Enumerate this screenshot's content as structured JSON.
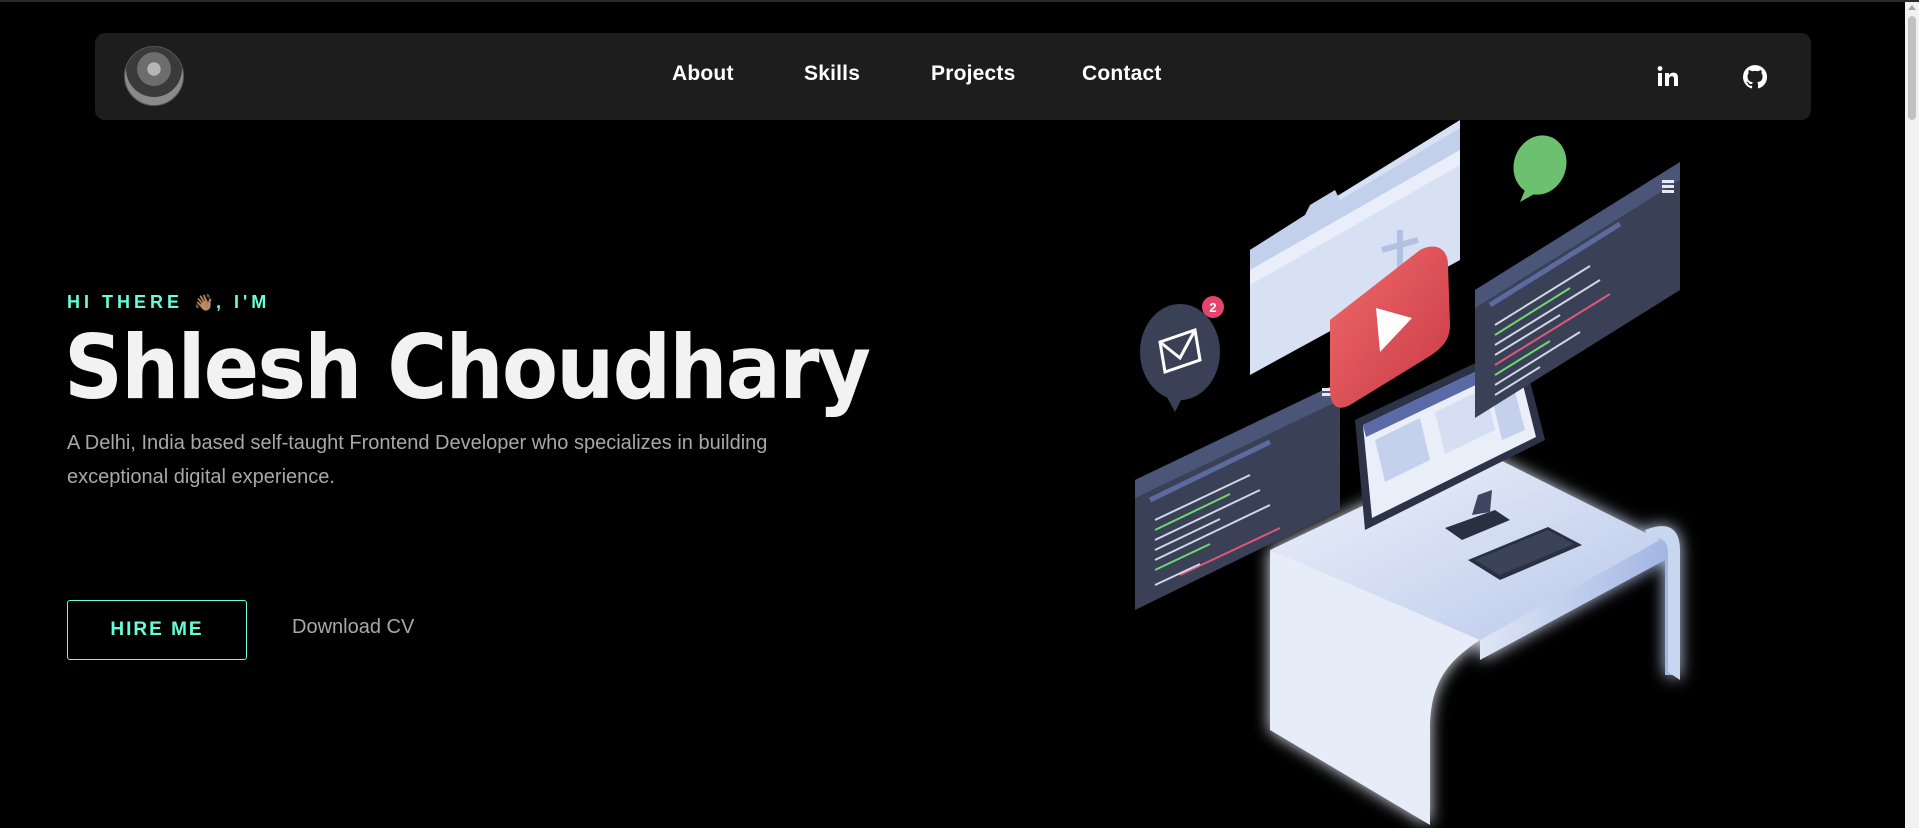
{
  "nav": {
    "links": [
      "About",
      "Skills",
      "Projects",
      "Contact"
    ],
    "social": [
      {
        "icon": "linkedin-icon",
        "label": "in"
      },
      {
        "icon": "github-icon"
      }
    ]
  },
  "hero": {
    "greeting_before": "HI THERE",
    "greeting_emoji": "👋🏽",
    "greeting_after": ", I'M",
    "name": "Shlesh Choudhary",
    "intro": "A Delhi, India based self-taught Frontend Developer who specializes in building exceptional digital experience.",
    "hire_label": "HIRE ME",
    "cv_label": "Download CV",
    "notification_count": "2"
  },
  "colors": {
    "accent": "#64ffda",
    "nav_bg": "#1d1d1d",
    "page_bg": "#000000",
    "muted_text": "#a8a8a8"
  }
}
